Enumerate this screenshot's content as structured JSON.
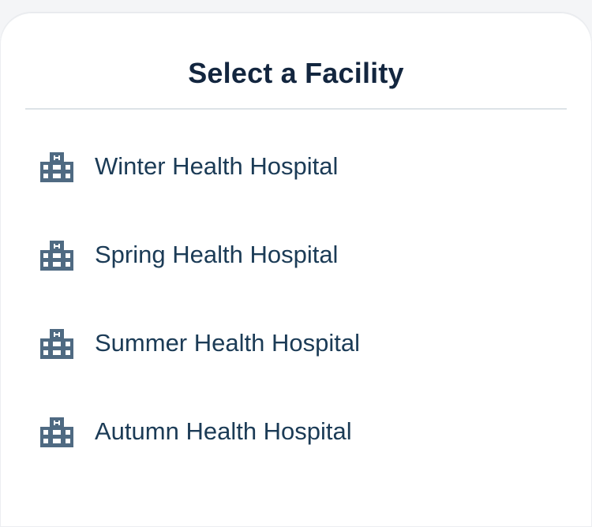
{
  "sheet": {
    "title": "Select a Facility"
  },
  "facilities": [
    {
      "name": "Winter Health Hospital",
      "icon": "hospital-building-icon"
    },
    {
      "name": "Spring Health Hospital",
      "icon": "hospital-building-icon"
    },
    {
      "name": "Summer Health Hospital",
      "icon": "hospital-building-icon"
    },
    {
      "name": "Autumn Health Hospital",
      "icon": "hospital-building-icon"
    }
  ],
  "colors": {
    "title": "#13263f",
    "label": "#1b3b56",
    "icon": "#4f6a82",
    "divider": "#dde3e7"
  }
}
